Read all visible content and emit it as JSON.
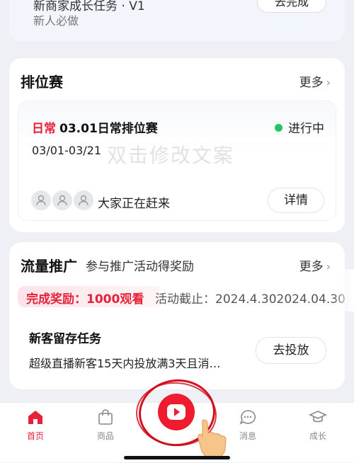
{
  "top_card": {
    "title": "新商家成长任务 · V1",
    "subtitle": "新人必做",
    "button_label": "去完成"
  },
  "ranking": {
    "section_title": "排位赛",
    "more_label": "更多",
    "tag": "日常",
    "title": "03.01日常排位赛",
    "status": "进行中",
    "date_range": "03/01-03/21",
    "watermark": "双击修改文案",
    "crowd_text": "大家正在赶来",
    "detail_button": "详情"
  },
  "traffic": {
    "section_title": "流量推广",
    "subtitle": "参与推广活动得奖励",
    "more_label": "更多",
    "reward": "完成奖励：1000观看",
    "deadline": "活动截止：2024.4.302024.04.30",
    "task_title": "新客留存任务",
    "task_desc": "超级直播新客15天内投放满3天且消…",
    "invest_button": "去投放"
  },
  "tabbar": {
    "home": "首页",
    "products": "商品",
    "messages": "消息",
    "growth": "成长"
  },
  "colors": {
    "accent": "#e5223a",
    "status_green": "#22c55e",
    "background": "#eef0f5"
  },
  "icons": [
    "home-icon",
    "shopping-bag-icon",
    "live-play-icon",
    "message-icon",
    "graduation-cap-icon",
    "chevron-right-icon",
    "user-avatar-icon"
  ]
}
